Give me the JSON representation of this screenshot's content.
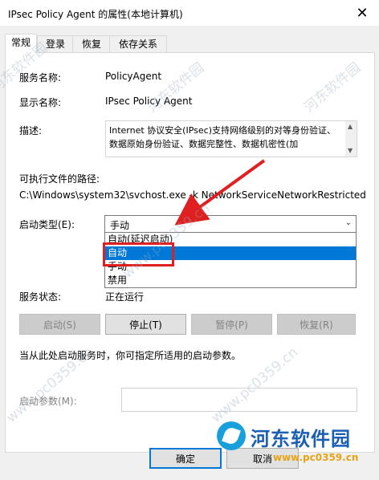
{
  "window": {
    "title": "IPsec Policy Agent 的属性(本地计算机)",
    "close_glyph": "✕"
  },
  "tabs": [
    {
      "label": "常规",
      "active": true
    },
    {
      "label": "登录",
      "active": false
    },
    {
      "label": "恢复",
      "active": false
    },
    {
      "label": "依存关系",
      "active": false
    }
  ],
  "general": {
    "service_name_label": "服务名称:",
    "service_name": "PolicyAgent",
    "display_name_label": "显示名称:",
    "display_name": "IPsec Policy Agent",
    "description_label": "描述:",
    "description": "Internet 协议安全(IPsec)支持网络级别的对等身份验证、数据原始身份验证、数据完整性、数据机密性(加",
    "exe_path_label": "可执行文件的路径:",
    "exe_path": "C:\\Windows\\system32\\svchost.exe -k NetworkServiceNetworkRestricted",
    "startup_type_label": "启动类型(E):",
    "startup_type_value": "手动",
    "startup_options": [
      "自动(延迟启动)",
      "自动",
      "手动",
      "禁用"
    ],
    "startup_selected_index": 1,
    "status_label": "服务状态:",
    "status_value": "正在运行",
    "buttons": {
      "start": "启动(S)",
      "stop": "停止(T)",
      "pause": "暂停(P)",
      "resume": "恢复(R)"
    },
    "hint": "当从此处启动服务时，你可指定所适用的启动参数。",
    "params_label": "启动参数(M):",
    "params_value": ""
  },
  "footer": {
    "ok": "确定",
    "cancel": "取消"
  },
  "watermark": {
    "logo_text": "河东软件园",
    "url": "www.pc0359.cn",
    "overlay_text": "www.pc0359.cn",
    "overlay_text2": "河东软件园"
  },
  "colors": {
    "accent": "#0078d7",
    "highlight_red": "#e02020",
    "logo_blue": "#19a0dc"
  }
}
